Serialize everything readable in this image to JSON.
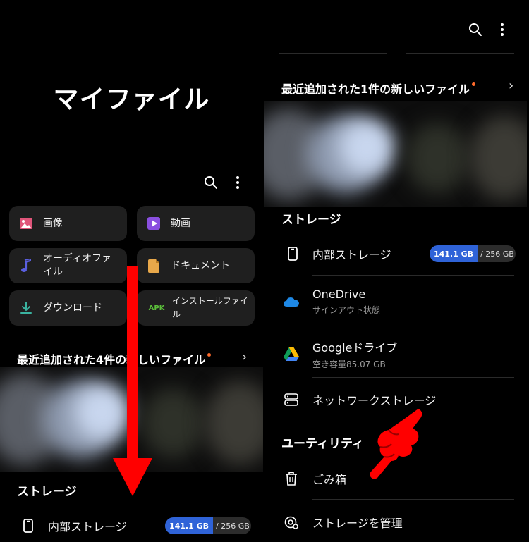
{
  "left": {
    "app_title": "マイファイル",
    "categories": [
      {
        "label": "画像",
        "icon": "image-icon",
        "color": "#e0557a"
      },
      {
        "label": "動画",
        "icon": "video-icon",
        "color": "#8a4fe0"
      },
      {
        "label": "オーディオファイル",
        "icon": "music-note-icon",
        "color": "#5a5fe0"
      },
      {
        "label": "ドキュメント",
        "icon": "document-icon",
        "color": "#e8a84a"
      },
      {
        "label": "ダウンロード",
        "icon": "download-icon",
        "color": "#3ab3a0"
      },
      {
        "label": "インストールファイル",
        "icon": "apk-icon",
        "color": "#5bbf3a",
        "icon_text": "APK"
      }
    ],
    "recent_title": "最近追加された4件の新しいファイル",
    "storage_title": "ストレージ",
    "internal_storage": {
      "label": "内部ストレージ",
      "used": "141.1 GB",
      "total": "/ 256 GB"
    }
  },
  "right": {
    "recent_title": "最近追加された1件の新しいファイル",
    "storage_title": "ストレージ",
    "storage_items": [
      {
        "label": "内部ストレージ",
        "used": "141.1 GB",
        "total": "/ 256 GB",
        "icon": "phone-icon"
      },
      {
        "label": "OneDrive",
        "sub": "サインアウト状態",
        "icon": "onedrive-icon"
      },
      {
        "label": "Googleドライブ",
        "sub": "空き容量85.07 GB",
        "icon": "google-drive-icon"
      },
      {
        "label": "ネットワークストレージ",
        "icon": "network-storage-icon"
      }
    ],
    "utility_title": "ユーティリティ",
    "utility_items": [
      {
        "label": "ごみ箱",
        "icon": "trash-icon"
      },
      {
        "label": "ストレージを管理",
        "icon": "storage-manage-icon"
      }
    ]
  },
  "colors": {
    "accent": "#2f63d8",
    "arrow": "#ff0000",
    "card": "#1f1f1f",
    "background": "#000000"
  }
}
